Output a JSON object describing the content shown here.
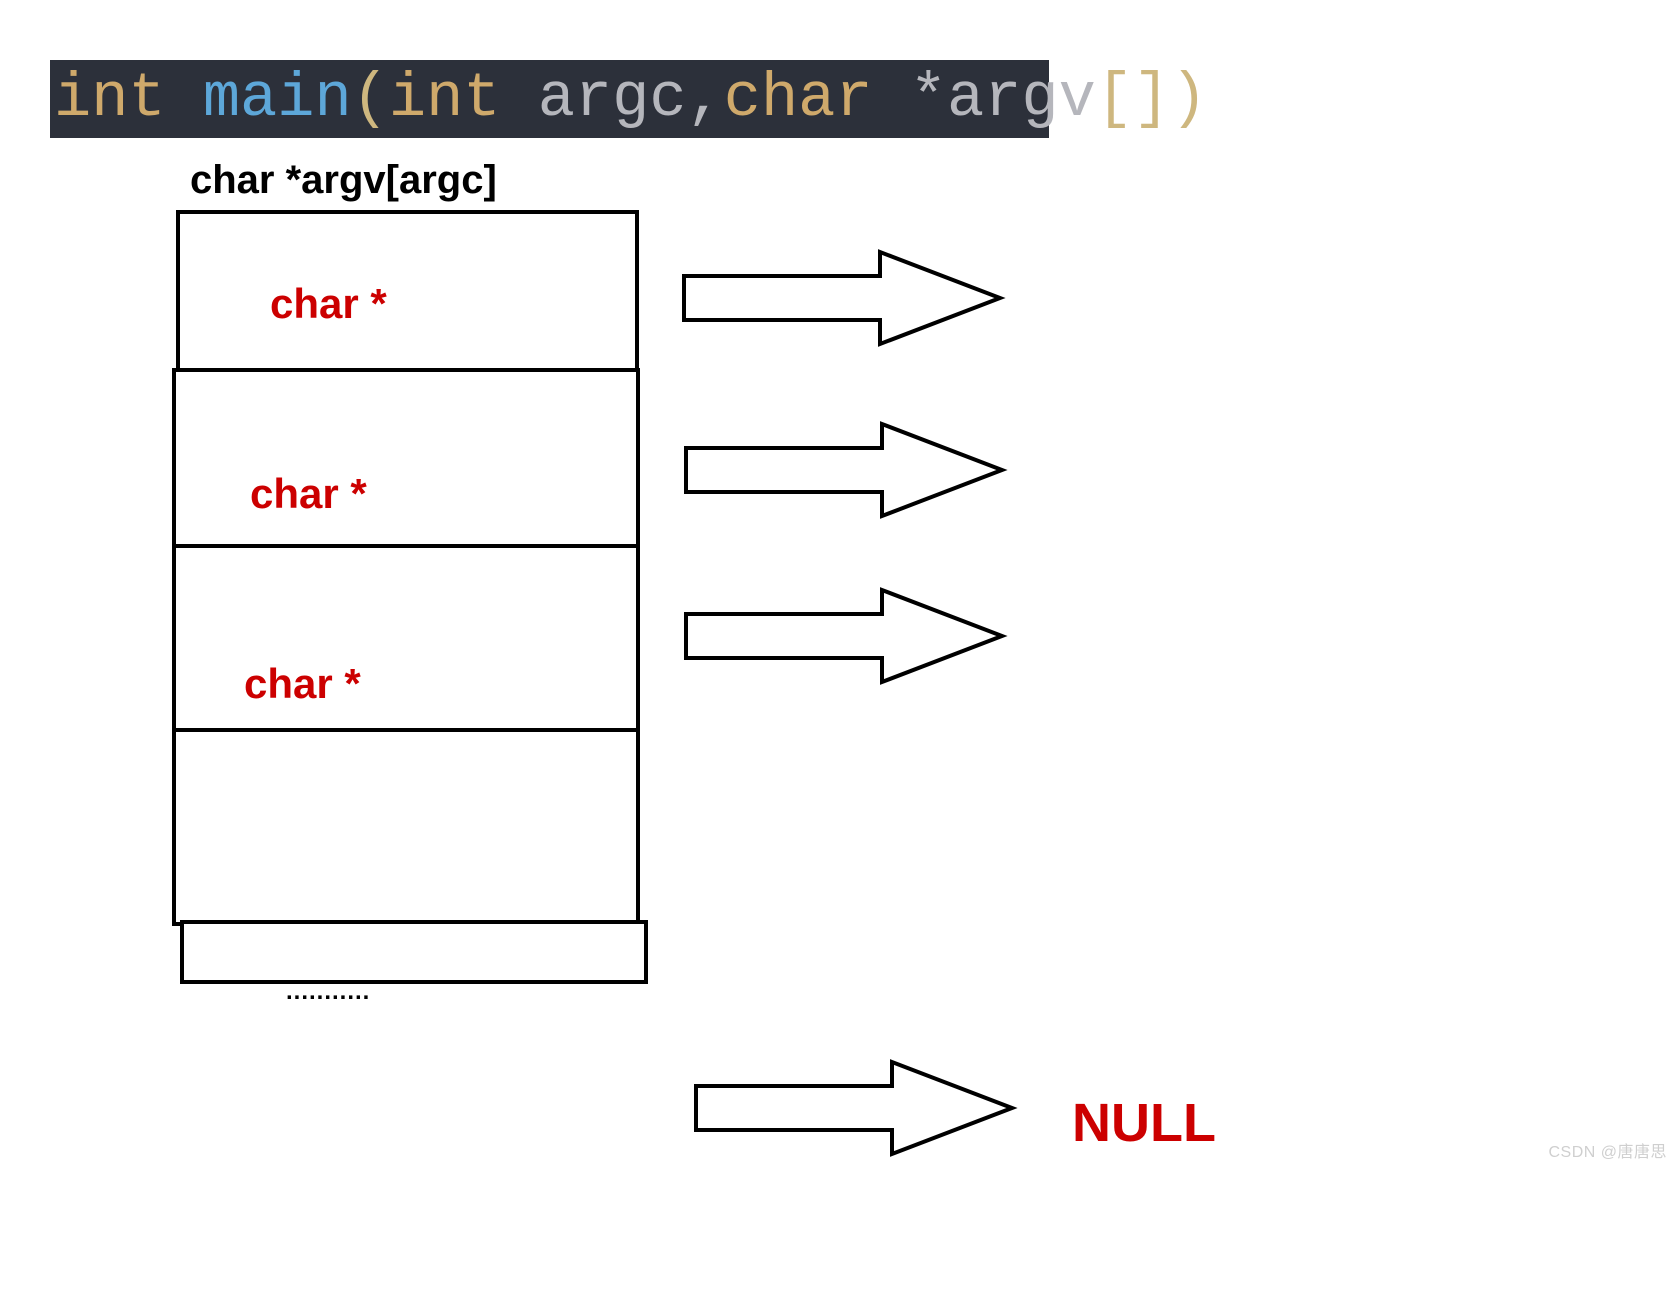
{
  "code": {
    "int": "int ",
    "main": "main",
    "open": "(",
    "arg1_type": "int ",
    "arg1_id": "argc",
    "comma": ",",
    "arg2_type": "char ",
    "star": "*",
    "arg2_id": "argv",
    "brackets_open": "[",
    "brackets_close": "]",
    "close": ")"
  },
  "array_label": "char *argv[argc]",
  "cells": {
    "c0": "char *",
    "c1": "char *",
    "c2": "char *"
  },
  "dots": "...........",
  "null_label": "NULL",
  "watermark": "CSDN @唐唐思"
}
